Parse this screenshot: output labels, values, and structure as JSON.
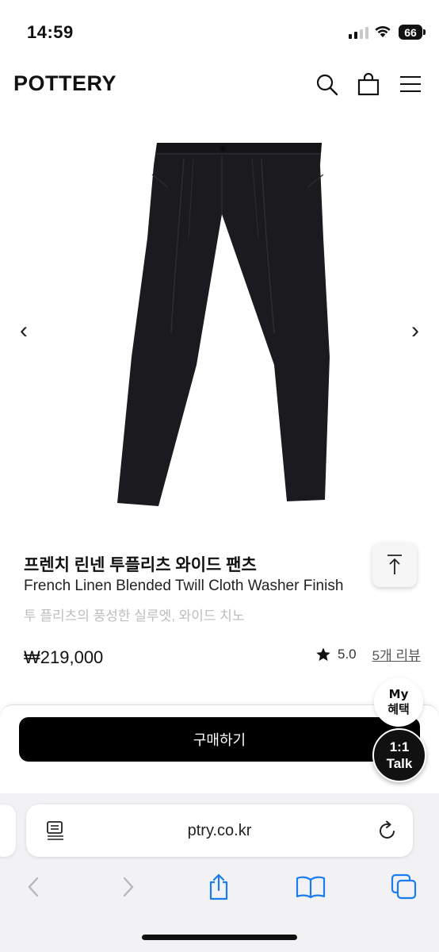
{
  "status_bar": {
    "time": "14:59",
    "battery": "66"
  },
  "header": {
    "brand": "POTTERY"
  },
  "product": {
    "name_ko": "프렌치 린넨 투플리츠 와이드 팬츠",
    "name_en": "French Linen Blended Twill Cloth Washer Finish",
    "subtitle": "투 플리츠의 풍성한 실루엣, 와이드 치노",
    "price": "₩219,000",
    "rating": "5.0",
    "reviews": "5개 리뷰"
  },
  "purchase": {
    "button_label": "구매하기"
  },
  "floating": {
    "benefit_line1": "My",
    "benefit_line2": "혜택",
    "talk_line1": "1:1",
    "talk_line2": "Talk"
  },
  "browser": {
    "url": "ptry.co.kr"
  },
  "colors": {
    "accent": "#000000",
    "link_blue": "#1a7cf0",
    "disabled_gray": "#b8b8bc"
  }
}
